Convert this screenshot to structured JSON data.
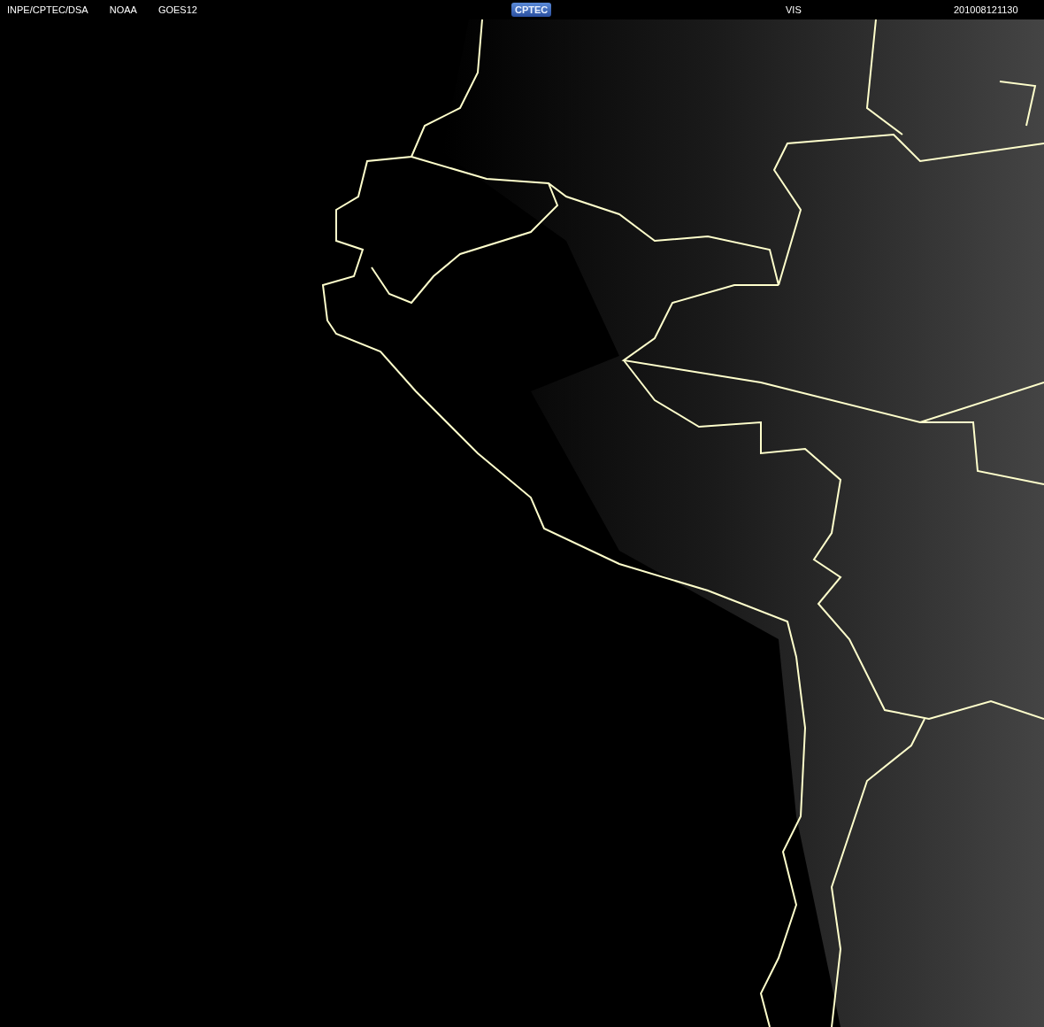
{
  "header": {
    "source": "INPE/CPTEC/DSA",
    "agency": "NOAA",
    "satellite": "GOES12",
    "logo": "CPTEC",
    "channel": "VIS",
    "timestamp": "201008121130"
  }
}
